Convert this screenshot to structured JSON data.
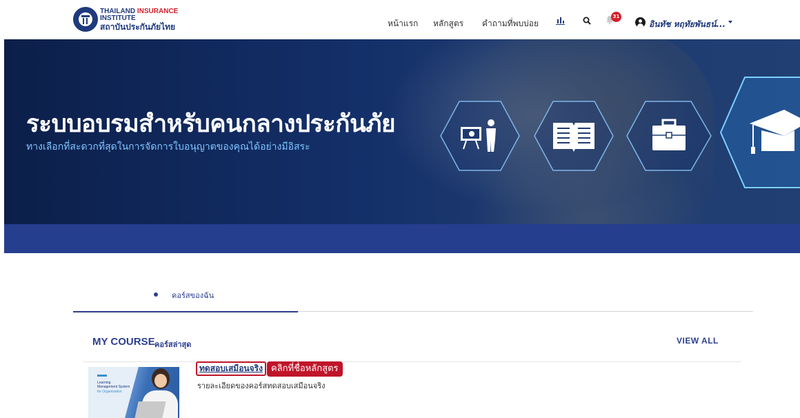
{
  "logo": {
    "line1_a": "THAILAND",
    "line1_b": "INSURANCE",
    "line2": "INSTITUTE",
    "line3": "สถาบันประกันภัยไทย"
  },
  "nav": {
    "items": [
      {
        "label": "หน้าแรก"
      },
      {
        "label": "หลักสูตร"
      },
      {
        "label": "คำถามที่พบบ่อย"
      }
    ],
    "notification_count": "31",
    "user_name": "อินทัช หฤทัยพันธน์..."
  },
  "banner": {
    "title": "ระบบอบรมสำหรับคนกลางประกันภัย",
    "subtitle": "ทางเลือกที่สะดวกที่สุดในการจัดการใบอนุญาตของคุณได้อย่างมีอิสระ",
    "icons": [
      "presentation-icon",
      "book-icon",
      "briefcase-icon",
      "graduation-cap-icon"
    ]
  },
  "tabs": [
    {
      "label": "คอร์สของฉัน",
      "active": true
    }
  ],
  "my_course": {
    "title": "MY COURSE",
    "subtitle": "คอร์สล่าสุด",
    "view_all": "VIEW ALL",
    "courses": [
      {
        "name": "ทดสอบเสมือนจริง",
        "description": "รายละเอียดของคอร์สทดสอบเสมือนจริง",
        "thumb_line1": "Learning",
        "thumb_line2": "Management System",
        "thumb_line3": "for Organization"
      }
    ],
    "tooltip": "คลิกที่ชื่อหลักสูตร"
  },
  "colors": {
    "brand_navy": "#1f3a7d",
    "brand_red": "#d3202a",
    "banner_bar": "#263e8e",
    "highlight": "#c0142a"
  }
}
